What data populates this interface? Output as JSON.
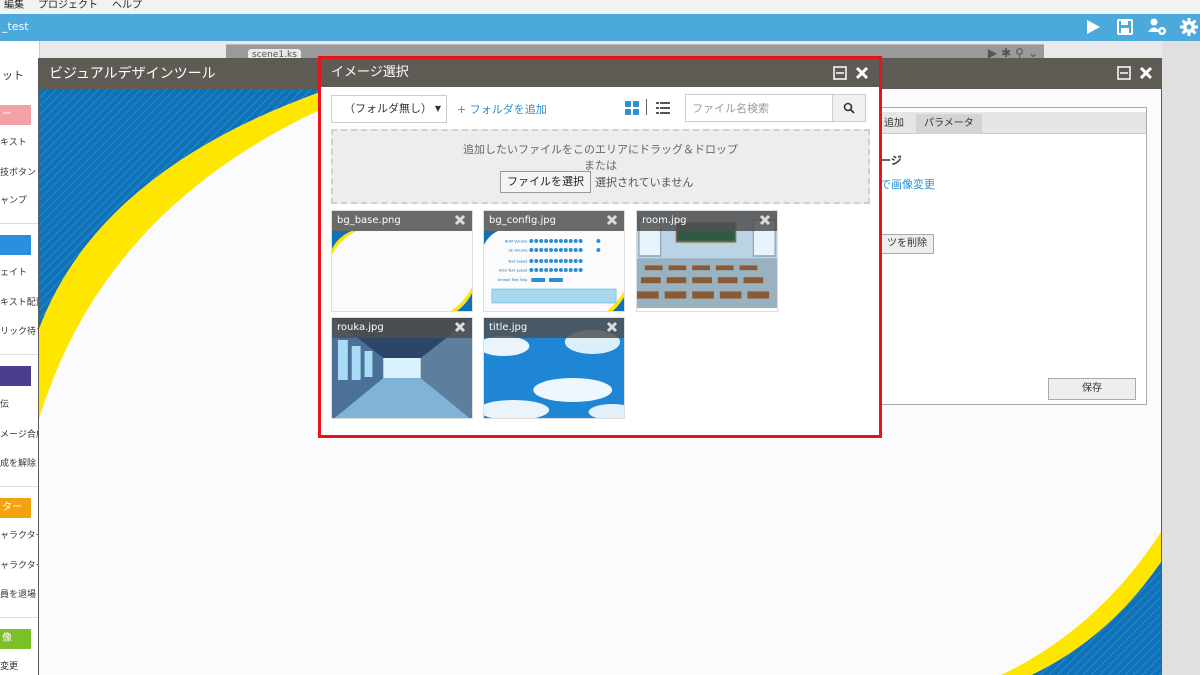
{
  "menu": {
    "items": [
      "編集",
      "プロジェクト",
      "ヘルプ"
    ]
  },
  "titlebar": {
    "project": "_test"
  },
  "toolbar_icons": [
    "play-icon",
    "save-icon",
    "settings-users-icon",
    "gear-icon"
  ],
  "scene": {
    "tab": "scene1.ks"
  },
  "palette": {
    "tab": "ット",
    "sections": [
      {
        "label": "ー",
        "color": "#f4a0a8",
        "items": [
          "キスト",
          "技ボタン",
          "ャンプ"
        ]
      },
      {
        "label": "",
        "color": "#2b8fe0",
        "items": [
          "ェイト",
          "キスト配置",
          "リック待ち"
        ]
      },
      {
        "label": "",
        "color": "#4a3f8c",
        "items": [
          "伝",
          "メージ合成",
          "成を解除"
        ]
      },
      {
        "label": "ター",
        "color": "#f4a20f",
        "items": [
          "ャラクター",
          "ャラクター",
          "員を退場"
        ]
      },
      {
        "label": "像",
        "color": "#7dbf2a",
        "items": [
          "変更"
        ]
      }
    ]
  },
  "vdt": {
    "title": "ビジュアルデザインツール",
    "panel": {
      "tabs": [
        "追加",
        "パラメータ"
      ],
      "label": "ージ",
      "link": "で画像変更",
      "delete_button": "ツを削除",
      "save_button": "保存"
    }
  },
  "modal": {
    "title": "イメージ選択",
    "folder_select": "（フォルダ無し）",
    "add_folder": "+ フォルダを追加",
    "search_placeholder": "ファイル名検索",
    "dropzone": {
      "line1": "追加したいファイルをこのエリアにドラッグ＆ドロップ",
      "line2": "または",
      "file_button": "ファイルを選択",
      "file_status": "選択されていません"
    },
    "images": [
      {
        "name": "bg_base.png"
      },
      {
        "name": "bg_config.jpg"
      },
      {
        "name": "room.jpg"
      },
      {
        "name": "rouka.jpg"
      },
      {
        "name": "title.jpg"
      }
    ],
    "thumb_config_labels": [
      "BGM Volume",
      "SE Volume",
      "Text Speed",
      "Auto Text Speed",
      "Unread Text Skip"
    ]
  },
  "colors": {
    "titlebar": "#4ba9dc",
    "window_header": "#5e5b55",
    "highlight": "#e5131b",
    "link": "#2a8fd3",
    "bg_blue": "#0e72b8",
    "bg_yellow": "#ffe600"
  }
}
